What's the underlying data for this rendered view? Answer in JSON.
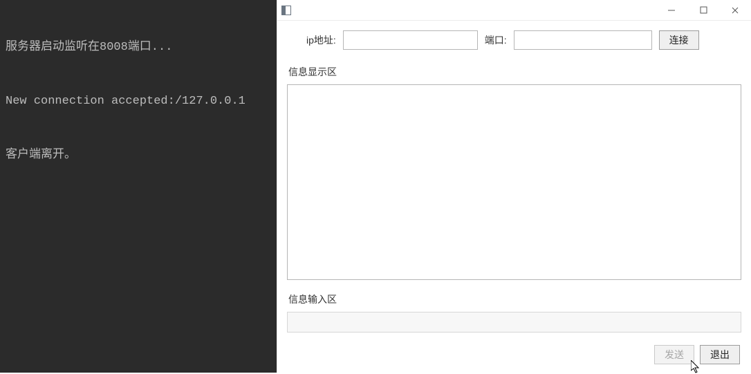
{
  "terminal": {
    "lines": [
      "服务器启动监听在8008端口...",
      "New connection accepted:/127.0.0.1",
      "客户端离开。"
    ]
  },
  "window": {
    "title": ""
  },
  "connection": {
    "ip_label": "ip地址:",
    "ip_value": "",
    "port_label": "端口:",
    "port_value": "",
    "connect_label": "连接"
  },
  "display": {
    "section_label": "信息显示区",
    "content": ""
  },
  "input": {
    "section_label": "信息输入区",
    "value": ""
  },
  "actions": {
    "send_label": "发送",
    "exit_label": "退出"
  }
}
